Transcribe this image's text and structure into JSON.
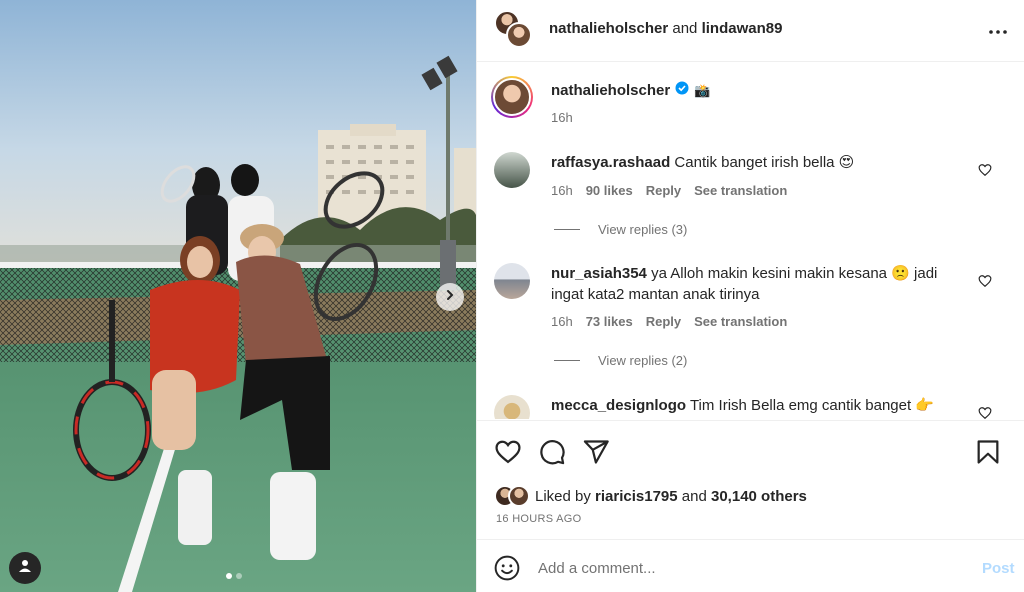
{
  "header": {
    "user1": "nathalieholscher",
    "and": "and",
    "user2": "lindawan89",
    "more_icon": "more-horizontal-icon"
  },
  "caption": {
    "username": "nathalieholscher",
    "verified_icon": "verified-badge-icon",
    "emoji": "📸",
    "time": "16h"
  },
  "comments": [
    {
      "username": "raffasya.rashaad",
      "text": "Cantik banget irish bella 😍",
      "time": "16h",
      "likes": "90 likes",
      "reply": "Reply",
      "translate": "See translation",
      "view_replies": "View replies (3)"
    },
    {
      "username": "nur_asiah354",
      "text": "ya Alloh makin kesini makin kesana 🙁 jadi ingat kata2 mantan anak tirinya",
      "time": "16h",
      "likes": "73 likes",
      "reply": "Reply",
      "translate": "See translation",
      "view_replies": "View replies (2)"
    },
    {
      "username": "mecca_designlogo",
      "text": "Tim Irish Bella emg cantik banget 👉"
    }
  ],
  "actions": {
    "like_icon": "heart-icon",
    "comment_icon": "comment-icon",
    "share_icon": "send-icon",
    "save_icon": "bookmark-icon"
  },
  "likes": {
    "prefix": "Liked by",
    "user": "riaricis1795",
    "and": "and",
    "others": "30,140 others"
  },
  "time_ago": "16 HOURS AGO",
  "add_comment": {
    "placeholder": "Add a comment...",
    "post_label": "Post",
    "emoji_icon": "smiley-icon"
  },
  "media": {
    "next_icon": "chevron-right-icon",
    "user_tag_icon": "user-tag-icon",
    "carousel_count": 2,
    "carousel_active": 1
  },
  "colors": {
    "link_disabled": "#b3dbff",
    "text": "#262626",
    "secondary": "#737373",
    "verified": "#0095f6"
  }
}
